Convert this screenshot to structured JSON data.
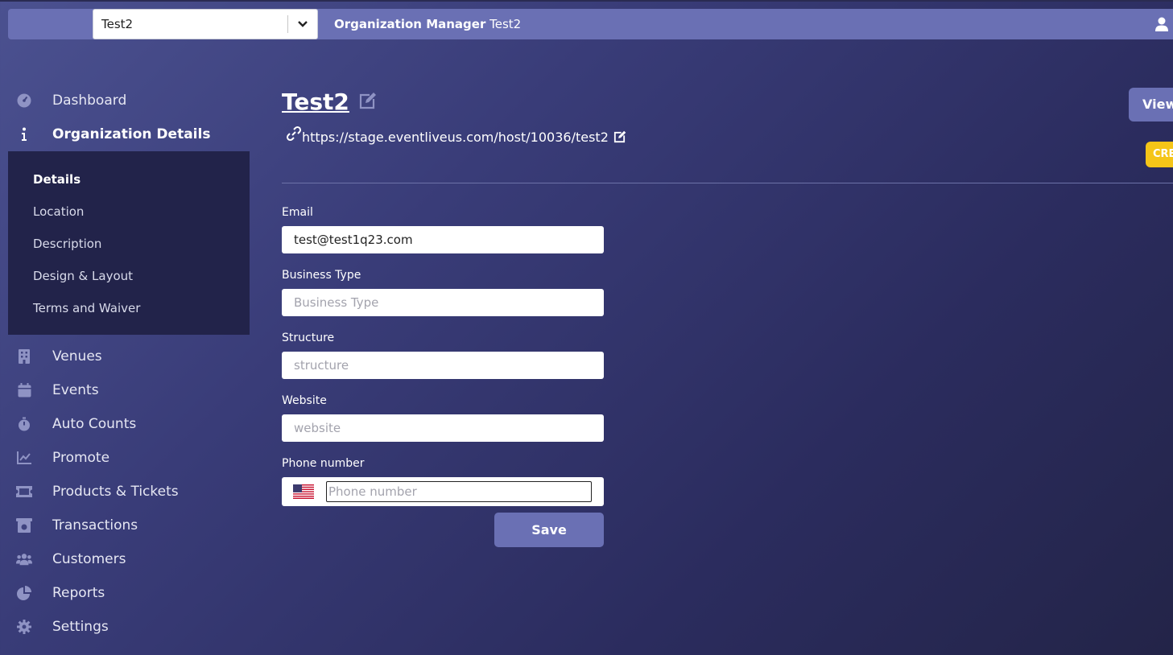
{
  "topbar": {
    "org_select_value": "Test2",
    "title_prefix": "Organization Manager",
    "title_org": "Test2"
  },
  "sidebar": {
    "items": [
      {
        "label": "Dashboard",
        "icon": "dashboard-icon"
      },
      {
        "label": "Organization Details",
        "icon": "info-icon",
        "active": true
      },
      {
        "label": "Venues",
        "icon": "building-icon"
      },
      {
        "label": "Events",
        "icon": "calendar-icon"
      },
      {
        "label": "Auto Counts",
        "icon": "stopwatch-icon"
      },
      {
        "label": "Promote",
        "icon": "chart-line-icon"
      },
      {
        "label": "Products & Tickets",
        "icon": "ticket-icon"
      },
      {
        "label": "Transactions",
        "icon": "cash-register-icon"
      },
      {
        "label": "Customers",
        "icon": "users-icon"
      },
      {
        "label": "Reports",
        "icon": "pie-chart-icon"
      },
      {
        "label": "Settings",
        "icon": "gear-icon"
      }
    ],
    "submenu": [
      {
        "label": "Details",
        "active": true
      },
      {
        "label": "Location"
      },
      {
        "label": "Description"
      },
      {
        "label": "Design & Layout"
      },
      {
        "label": "Terms and Waiver"
      }
    ]
  },
  "main": {
    "title": "Test2",
    "url": "https://stage.eventliveus.com/host/10036/test2",
    "view_button": "View",
    "create_button": "CRE",
    "form": {
      "email_label": "Email",
      "email_value": "test@test1q23.com",
      "business_type_label": "Business Type",
      "business_type_placeholder": "Business Type",
      "structure_label": "Structure",
      "structure_placeholder": "structure",
      "website_label": "Website",
      "website_placeholder": "website",
      "phone_label": "Phone number",
      "phone_placeholder": "Phone number",
      "save_label": "Save"
    }
  },
  "colors": {
    "accent": "#6a70b4",
    "submenu_bg": "#22234a",
    "create": "#f5c518"
  }
}
